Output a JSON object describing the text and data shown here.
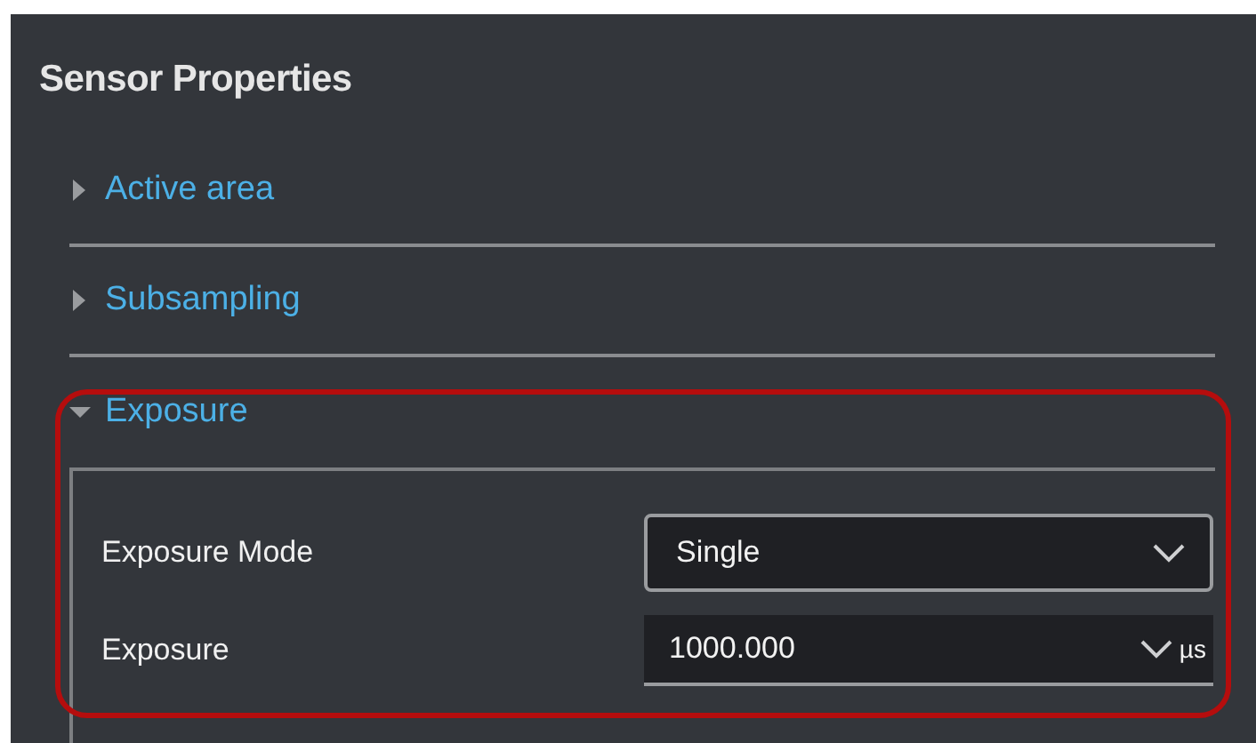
{
  "panel": {
    "title": "Sensor Properties"
  },
  "sections": [
    {
      "label": "Active area",
      "expanded": false,
      "highlighted": false
    },
    {
      "label": "Subsampling",
      "expanded": false,
      "highlighted": false
    },
    {
      "label": "Exposure",
      "expanded": true,
      "highlighted": true,
      "fields": [
        {
          "kind": "select",
          "label": "Exposure Mode",
          "value": "Single"
        },
        {
          "kind": "number",
          "label": "Exposure",
          "value": "1000.000",
          "unit": "µs"
        }
      ]
    }
  ]
}
